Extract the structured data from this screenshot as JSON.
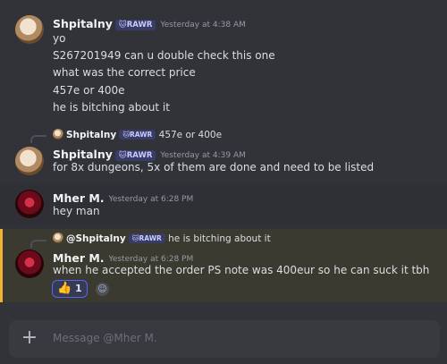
{
  "messages": [
    {
      "author": "Shpitalny",
      "tag": "🐱RAWR",
      "timestamp": "Yesterday at 4:38 AM",
      "lines": [
        "yo",
        "S267201949 can u double check this one",
        "what was the correct price",
        "457e or 400e",
        "he is bitching about it"
      ]
    },
    {
      "reply": {
        "author": "Shpitalny",
        "tag": "🐱RAWR",
        "text": "457e or 400e"
      },
      "author": "Shpitalny",
      "tag": "🐱RAWR",
      "timestamp": "Yesterday at 4:39 AM",
      "lines": [
        "for 8x dungeons, 5x of them are done and need to be listed"
      ]
    },
    {
      "author": "Mher M.",
      "timestamp": "Yesterday at 6:28 PM",
      "lines": [
        "hey man"
      ]
    },
    {
      "reply": {
        "author": "@Shpitalny",
        "tag": "🐱RAWR",
        "text": "he is bitching about it"
      },
      "author": "Mher M.",
      "timestamp": "Yesterday at 6:28 PM",
      "lines": [
        "when he accepted the order PS note was 400eur so he can suck it tbh"
      ],
      "reaction": {
        "emoji": "👍",
        "count": "1"
      }
    }
  ],
  "composer": {
    "placeholder": "Message @Mher M."
  },
  "icons": {
    "plus": "plus-icon",
    "add_reaction": "add-reaction-icon",
    "reaction_emoji": "thumbs-up-icon"
  },
  "colors": {
    "background": "#313338",
    "highlight_border": "#f0b232",
    "reaction_border": "#5865f2"
  }
}
